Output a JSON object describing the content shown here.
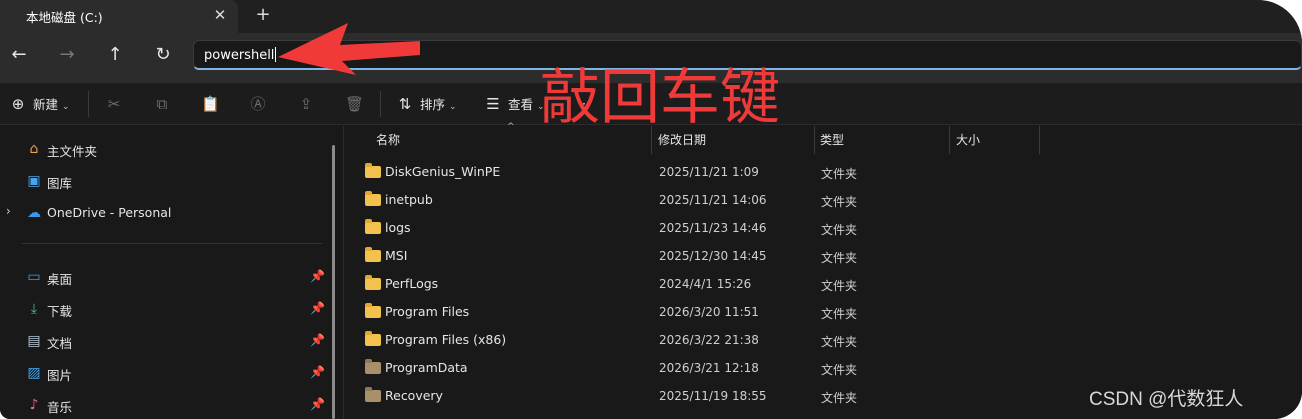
{
  "tab": {
    "title": "本地磁盘 (C:)",
    "close": "✕",
    "new_tab": "+"
  },
  "nav": {
    "back_icon": "arrow-left-icon",
    "forward_icon": "arrow-right-icon",
    "up_icon": "arrow-up-icon",
    "refresh_icon": "refresh-icon",
    "address_value": "powershell"
  },
  "commands": {
    "new": "新建",
    "sort": "排序",
    "view": "查看",
    "more": "···"
  },
  "sidebar": {
    "items": [
      {
        "label": "主文件夹",
        "icon": "home-icon"
      },
      {
        "label": "图库",
        "icon": "gallery-icon"
      },
      {
        "label": "OneDrive - Personal",
        "icon": "cloud-icon"
      },
      {
        "label": "桌面",
        "icon": "desktop-icon",
        "pinned": true
      },
      {
        "label": "下载",
        "icon": "download-icon",
        "pinned": true
      },
      {
        "label": "文档",
        "icon": "document-icon",
        "pinned": true
      },
      {
        "label": "图片",
        "icon": "picture-icon",
        "pinned": true
      },
      {
        "label": "音乐",
        "icon": "music-icon",
        "pinned": true
      }
    ]
  },
  "columns": {
    "name": "名称",
    "modified": "修改日期",
    "type": "类型",
    "size": "大小"
  },
  "files": [
    {
      "name": "DiskGenius_WinPE",
      "modified": "2025/11/21 1:09",
      "type": "文件夹"
    },
    {
      "name": "inetpub",
      "modified": "2025/11/21 14:06",
      "type": "文件夹"
    },
    {
      "name": "logs",
      "modified": "2025/11/23 14:46",
      "type": "文件夹"
    },
    {
      "name": "MSI",
      "modified": "2025/12/30 14:45",
      "type": "文件夹"
    },
    {
      "name": "PerfLogs",
      "modified": "2024/4/1 15:26",
      "type": "文件夹"
    },
    {
      "name": "Program Files",
      "modified": "2026/3/20 11:51",
      "type": "文件夹"
    },
    {
      "name": "Program Files (x86)",
      "modified": "2026/3/22 21:38",
      "type": "文件夹"
    },
    {
      "name": "ProgramData",
      "modified": "2026/3/21 12:18",
      "type": "文件夹"
    },
    {
      "name": "Recovery",
      "modified": "2025/11/19 18:55",
      "type": "文件夹"
    }
  ],
  "annotation": {
    "text": "敲回车键",
    "color": "#f03a3a"
  },
  "watermark": "CSDN @代数狂人"
}
